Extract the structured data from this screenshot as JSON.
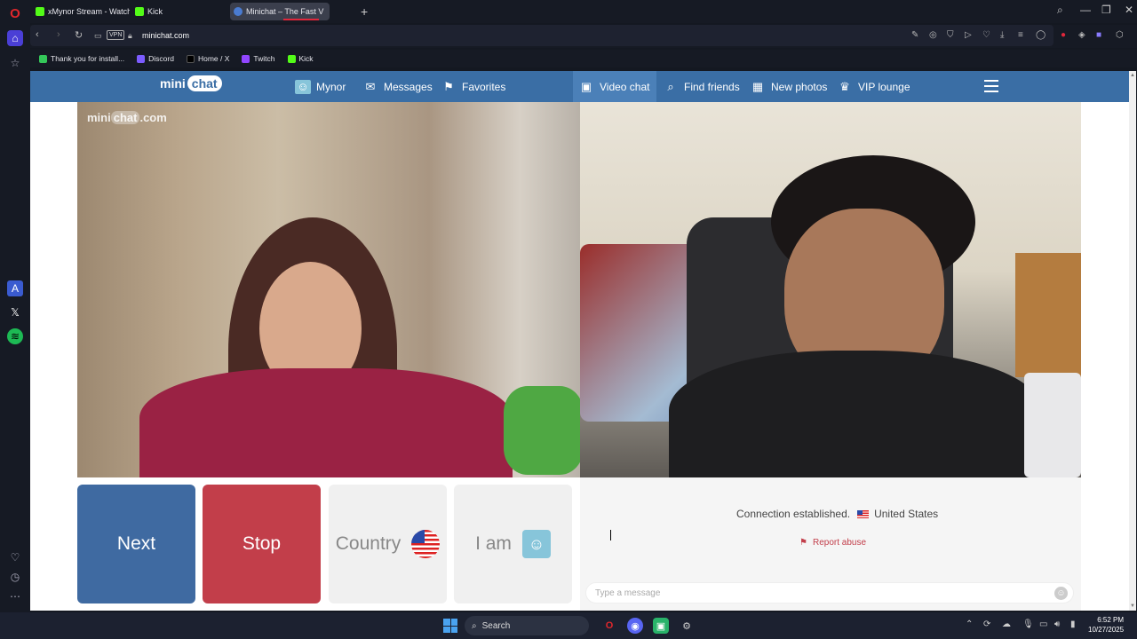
{
  "browser": {
    "tabs": [
      {
        "title": "xMynor Stream - Watch Li",
        "color": "#53fc18"
      },
      {
        "title": "Kick",
        "color": "#53fc18"
      },
      {
        "title": "Minichat – The Fast V",
        "color": "#4a7bd0",
        "active": true
      }
    ],
    "new_tab_icon": "plus-icon",
    "url": "minichat.com",
    "vpn_label": "VPN",
    "bookmarks": [
      {
        "label": "Thank you for install...",
        "color": "#34c759"
      },
      {
        "label": "Discord",
        "color": "#7c5cff"
      },
      {
        "label": "Home / X",
        "color": "#000000"
      },
      {
        "label": "Twitch",
        "color": "#9146ff"
      },
      {
        "label": "Kick",
        "color": "#53fc18"
      }
    ]
  },
  "site": {
    "logo_left": "mini",
    "logo_right": "chat",
    "nav": {
      "profile": "Mynor",
      "messages": "Messages",
      "favorites": "Favorites",
      "video_chat": "Video chat",
      "find_friends": "Find friends",
      "new_photos": "New photos",
      "vip": "VIP lounge"
    },
    "watermark_left": "mini",
    "watermark_mid": "chat",
    "watermark_right": ".com",
    "accent": "#3a6ea5"
  },
  "controls": {
    "next": "Next",
    "stop": "Stop",
    "country": "Country",
    "iam": "I am"
  },
  "chat": {
    "status": "Connection established.",
    "country": "United States",
    "report": "Report abuse",
    "placeholder": "Type a message"
  },
  "taskbar": {
    "search": "Search",
    "time": "6:52 PM",
    "date": "10/27/2025"
  }
}
